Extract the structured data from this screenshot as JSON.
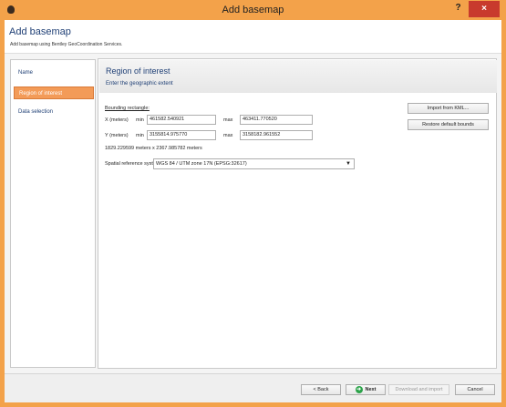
{
  "window": {
    "title": "Add basemap",
    "help_label": "?",
    "close_label": "×"
  },
  "header": {
    "title": "Add basemap",
    "subtitle": "Add basemap using Bentley GeoCoordination Services."
  },
  "sidebar": {
    "items": [
      {
        "label": "Name"
      },
      {
        "label": "Region of interest"
      },
      {
        "label": "Data selection"
      }
    ]
  },
  "main": {
    "section_title": "Region of interest",
    "section_subtitle": "Enter the geographic extent",
    "bounding_label": "Bounding rectangle:",
    "x_label": "X (meters)",
    "y_label": "Y (meters)",
    "min_label": "min",
    "max_label": "max",
    "x_min": "461582.540921",
    "x_max": "463411.770520",
    "y_min": "3155814.975770",
    "y_max": "3158182.961552",
    "extent_text": "1829.229599 meters x 2367.985782 meters",
    "srs_label": "Spatial reference system:",
    "srs_value": "WGS 84 / UTM zone 17N (EPSG:32617)",
    "import_kml_label": "Import from KML...",
    "restore_label": "Restore default bounds"
  },
  "footer": {
    "back_label": "< Back",
    "next_label": "Next",
    "download_label": "Download and import",
    "cancel_label": "Cancel"
  }
}
